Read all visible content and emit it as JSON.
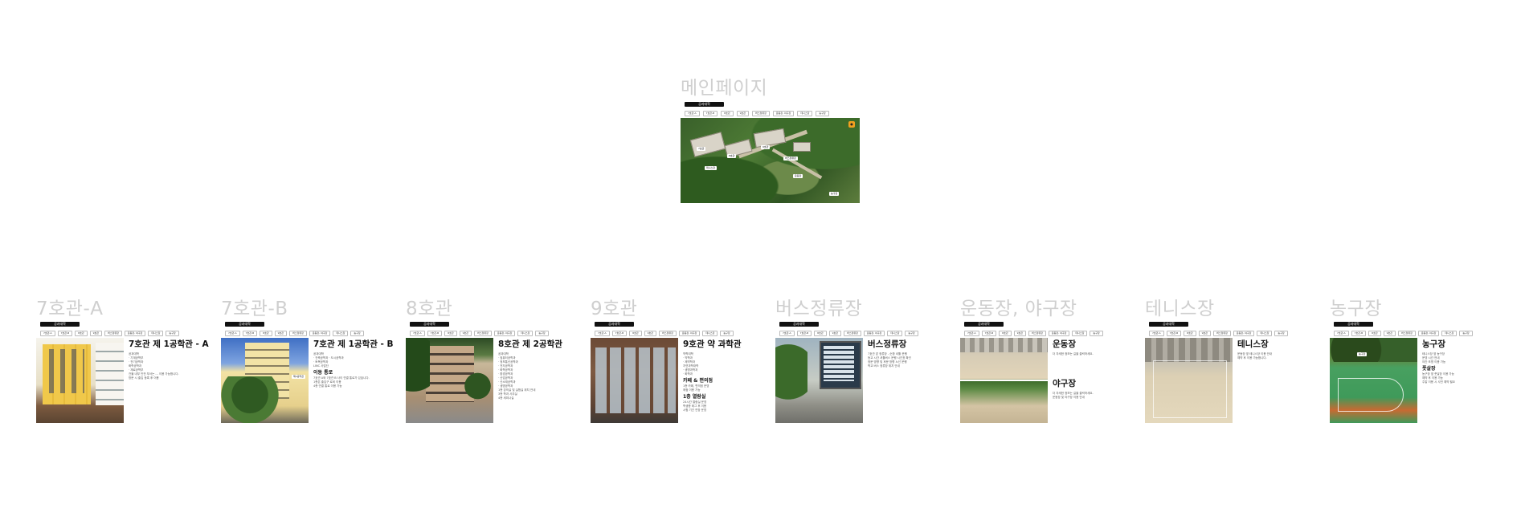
{
  "main_page": {
    "title": "메인페이지",
    "brand": "공과대학",
    "nav": [
      "7호관-A",
      "7호관-B",
      "8호관",
      "9호관",
      "버스정류장",
      "운동장, 야구장",
      "테니스장",
      "농구장"
    ],
    "map_labels": [
      "7호관",
      "8호관",
      "9호관",
      "버스정류장",
      "운동장",
      "테니스장",
      "농구장"
    ]
  },
  "cards": [
    {
      "frame_title": "7호관-A",
      "brand": "공과대학",
      "nav": [
        "7호관-A",
        "7호관-B",
        "8호관",
        "9호관",
        "버스정류장",
        "운동장, 야구장",
        "테니스장",
        "농구장"
      ],
      "heading": "7호관 제 1공학관 - A",
      "lines": [
        "공과대학",
        "· 기계공학부",
        "· 전기공학과",
        "",
        "화학공학과",
        "· 재료공학부",
        "",
        "건물 내부 안전 부서는 ... 이용 가능합니다.",
        "방문 시 출입 등록 후 이용"
      ]
    },
    {
      "frame_title": "7호관-B",
      "brand": "공과대학",
      "nav": [
        "7호관-A",
        "7호관-B",
        "8호관",
        "9호관",
        "버스정류장",
        "운동장, 야구장",
        "테니스장",
        "농구장"
      ],
      "heading": "7호관 제 1공학관 - B",
      "photo_tag": "제1공학관",
      "lines": [
        "공과대학",
        "· 건축공학과 · 도시공학과",
        "· 토목공학과",
        "",
        "LINC 사업단"
      ],
      "sub": "이동 통로",
      "lines2": [
        "7호관 A와 7호관 B 사이 연결 통로가 있습니다.",
        "",
        "1층은 출입구 로비 이용",
        "",
        "4층 연결 통로 이용 가능"
      ]
    },
    {
      "frame_title": "8호관",
      "brand": "공과대학",
      "nav": [
        "7호관-A",
        "7호관-B",
        "8호관",
        "9호관",
        "버스정류장",
        "운동장, 야구장",
        "테니스장",
        "농구장"
      ],
      "heading": "8호관 제 2공학관",
      "lines": [
        "공과대학",
        "· 컴퓨터공학과",
        "· 정보통신공학과",
        "· 전자공학과",
        "· 화학공학과",
        "· 환경공학과",
        "· 산업공학과",
        "· 신소재공학과",
        "· 생명공학과",
        "",
        "1층 강의실 및 실험실 위치 안내",
        "",
        "3층 학과 사무실",
        "",
        "4층 세미나실"
      ]
    },
    {
      "frame_title": "9호관",
      "brand": "공과대학",
      "nav": [
        "7호관-A",
        "7호관-B",
        "8호관",
        "9호관",
        "버스정류장",
        "운동장, 야구장",
        "테니스장",
        "농구장"
      ],
      "heading": "9호관 약 과학관",
      "lines": [
        "약학대학",
        "· 약학과",
        "· 제약학과",
        "자연과학대학",
        "· 생명과학과",
        "· 화학과"
      ],
      "sub": "카페 & 편의점",
      "lines2": [
        "1층 카페, 편의점 운영",
        "매점 이용 가능"
      ],
      "sub2": "1층 열람실",
      "lines3": [
        "24시간 열람실 운영",
        "학생증 태그 후 이용",
        "시험 기간 연장 운영"
      ]
    },
    {
      "frame_title": "버스정류장",
      "brand": "공과대학",
      "nav": [
        "7호관-A",
        "7호관-B",
        "8호관",
        "9호관",
        "버스정류장",
        "운동장, 야구장",
        "테니스장",
        "농구장"
      ],
      "heading": "버스정류장",
      "lines": [
        "7호관 앞 정류장 - 순환 셔틀 운행",
        "",
        "등교 시간 셔틀버스 운행 시간표 확인",
        "정문 방향 및 후문 방향 노선 운행",
        "",
        "학교 버스 정류장 위치 안내"
      ]
    },
    {
      "frame_title": "운동장, 야구장",
      "brand": "공과대학",
      "nav": [
        "7호관-A",
        "7호관-B",
        "8호관",
        "9호관",
        "버스정류장",
        "운동장, 야구장",
        "테니스장",
        "농구장"
      ],
      "heading": "운동장",
      "lines": [
        "더 자세한 정보는 길을 클릭하세요."
      ],
      "heading2": "야구장",
      "lines2": [
        "더 자세한 정보는 길을 클릭하세요.",
        "",
        "운동장 및 야구장 이용 안내"
      ]
    },
    {
      "frame_title": "테니스장",
      "brand": "공과대학",
      "nav": [
        "7호관-A",
        "7호관-B",
        "8호관",
        "9호관",
        "버스정류장",
        "운동장, 야구장",
        "테니스장",
        "농구장"
      ],
      "heading": "테니스장",
      "lines": [
        "운동장 옆 테니스장 이용 안내",
        "",
        "예약 후 이용 가능합니다."
      ]
    },
    {
      "frame_title": "농구장",
      "brand": "공과대학",
      "nav": [
        "7호관-A",
        "7호관-B",
        "8호관",
        "9호관",
        "버스정류장",
        "운동장, 야구장",
        "테니스장",
        "농구장"
      ],
      "heading": "농구장",
      "photo_tag": "농구장",
      "lines": [
        "테니스장 옆 농구장",
        "",
        "운영 시간 안내",
        "야간 조명 이용 가능"
      ],
      "sub": "풋살장",
      "lines2": [
        "농구장 옆 풋살장 이용 가능",
        "",
        "예약 후 이용 가능",
        "",
        "주말 이용 시 사전 예약 필요"
      ]
    }
  ]
}
